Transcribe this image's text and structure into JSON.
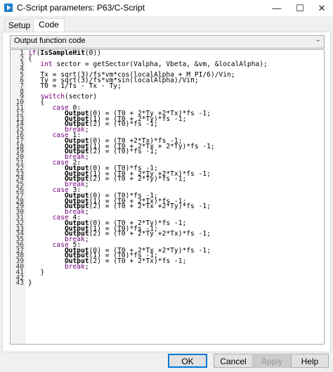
{
  "window": {
    "title": "C-Script parameters: P63/C-Script",
    "minimize": "—",
    "maximize": "☐",
    "close": "✕"
  },
  "tabs": [
    {
      "label": "Setup",
      "active": false
    },
    {
      "label": "Code",
      "active": true
    }
  ],
  "dropdown": {
    "selected": "Output function code",
    "arrow": "⌄"
  },
  "editor": {
    "lines": [
      {
        "n": "1",
        "t": "if(IsSampleHit(0))"
      },
      {
        "n": "2",
        "t": "{"
      },
      {
        "n": "3",
        "t": "   int sector = getSector(Valpha, Vbeta, &vm, &localAlpha);"
      },
      {
        "n": "4",
        "t": ""
      },
      {
        "n": "5",
        "t": "   Tx = sqrt(3)/fs*vm*cos(localAlpha + M_PI/6)/Vin;"
      },
      {
        "n": "6",
        "t": "   Ty = sqrt(3)/fs*vm*sin(localAlpha)/Vin;"
      },
      {
        "n": "7",
        "t": "   T0 = 1/fs - Tx - Ty;"
      },
      {
        "n": "8",
        "t": ""
      },
      {
        "n": "9",
        "t": "   switch(sector)"
      },
      {
        "n": "10",
        "t": "   {"
      },
      {
        "n": "11",
        "t": "      case 0:"
      },
      {
        "n": "12",
        "t": "         Output(0) = (T0 + 2*Ty +2*Tx)*fs -1;"
      },
      {
        "n": "13",
        "t": "         Output(1) = (T0 + 2*Ty)*fs -1;"
      },
      {
        "n": "14",
        "t": "         Output(2) = (T0)*fs -1;"
      },
      {
        "n": "15",
        "t": "         break;"
      },
      {
        "n": "16",
        "t": "      case 1:"
      },
      {
        "n": "17",
        "t": "         Output(0) = (T0 +2*Tx)*fs -1;"
      },
      {
        "n": "18",
        "t": "         Output(1) = (T0 + 2*Tx + 2*Ty)*fs -1;"
      },
      {
        "n": "19",
        "t": "         Output(2) = (T0)*fs -1;"
      },
      {
        "n": "20",
        "t": "         break;"
      },
      {
        "n": "21",
        "t": "      case 2:"
      },
      {
        "n": "22",
        "t": "         Output(0) = (T0)*fs -1;"
      },
      {
        "n": "23",
        "t": "         Output(1) = (T0 + 2*Ty +2*Tx)*fs -1;"
      },
      {
        "n": "24",
        "t": "         Output(2) = (T0 + 2*Ty)*fs -1;"
      },
      {
        "n": "25",
        "t": "         break;"
      },
      {
        "n": "26",
        "t": "      case 3:"
      },
      {
        "n": "27",
        "t": "         Output(0) = (T0)*fs -1;"
      },
      {
        "n": "28",
        "t": "         Output(1) = (T0 + 2*Tx)*fs -1;"
      },
      {
        "n": "29",
        "t": "         Output(2) = (T0 + 2*Tx +2*Ty)*fs -1;"
      },
      {
        "n": "30",
        "t": "         break;"
      },
      {
        "n": "31",
        "t": "      case 4:"
      },
      {
        "n": "32",
        "t": "         Output(0) = (T0 + 2*Ty)*fs -1;"
      },
      {
        "n": "33",
        "t": "         Output(1) = (T0)*fs -1;"
      },
      {
        "n": "34",
        "t": "         Output(2) = (T0 + 2*Ty +2*Tx)*fs -1;"
      },
      {
        "n": "35",
        "t": "         break;"
      },
      {
        "n": "36",
        "t": "      case 5:"
      },
      {
        "n": "37",
        "t": "         Output(0) = (T0 + 2*Tx +2*Ty)*fs -1;"
      },
      {
        "n": "38",
        "t": "         Output(1) = (T0)*fs -1;"
      },
      {
        "n": "39",
        "t": "         Output(2) = (T0 + 2*Tx)*fs -1;"
      },
      {
        "n": "40",
        "t": "         break;"
      },
      {
        "n": "41",
        "t": "   }"
      },
      {
        "n": "42",
        "t": ""
      },
      {
        "n": "43",
        "t": "}"
      }
    ]
  },
  "buttons": {
    "ok": "OK",
    "cancel": "Cancel",
    "apply": "Apply",
    "help": "Help"
  },
  "colors": {
    "keyword": "#7a0080",
    "accent": "#0078d7"
  }
}
